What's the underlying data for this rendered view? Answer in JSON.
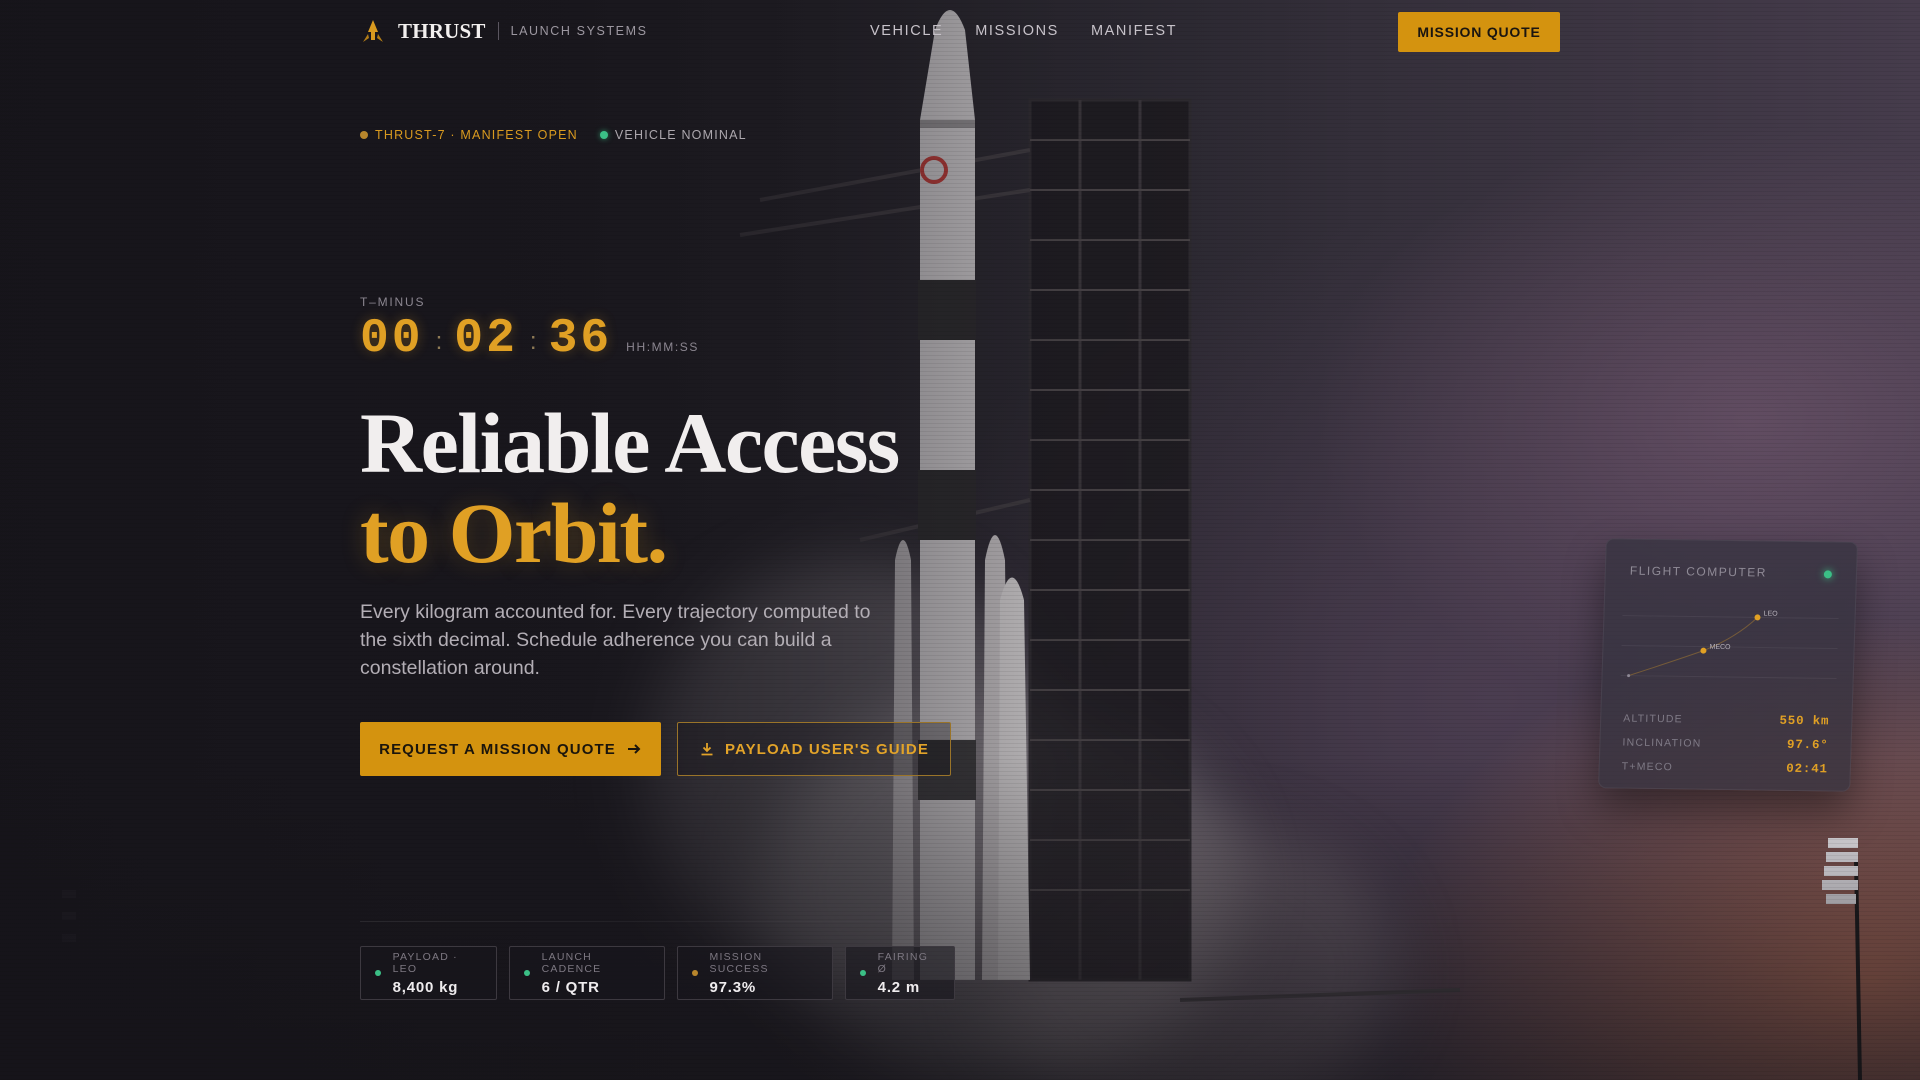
{
  "nav": {
    "brand_name": "THRUST",
    "brand_sub": "LAUNCH SYSTEMS",
    "links": [
      "VEHICLE",
      "MISSIONS",
      "MANIFEST"
    ],
    "cta_label": "MISSION QUOTE"
  },
  "status": {
    "manifest": "THRUST-7 · MANIFEST OPEN",
    "vehicle": "VEHICLE NOMINAL"
  },
  "countdown": {
    "label": "T–MINUS",
    "hours": "00",
    "minutes": "02",
    "seconds": "36",
    "unit": "HH:MM:SS"
  },
  "hero": {
    "headline_line1": "Reliable Access",
    "headline_line2": "to Orbit.",
    "lead": "Every kilogram accounted for. Every trajectory computed to the sixth decimal. Schedule adherence you can build a constellation around.",
    "primary_cta": "REQUEST A MISSION QUOTE",
    "secondary_cta": "PAYLOAD USER'S GUIDE"
  },
  "stats": [
    {
      "label": "PAYLOAD · LEO",
      "value": "8,400 kg",
      "dot": "#3bbf86"
    },
    {
      "label": "LAUNCH CADENCE",
      "value": "6 / QTR",
      "dot": "#3bbf86"
    },
    {
      "label": "MISSION SUCCESS",
      "value": "97.3%",
      "dot": "#b8862c"
    },
    {
      "label": "FAIRING Ø",
      "value": "4.2 m",
      "dot": "#3bbf86"
    }
  ],
  "flight_computer": {
    "title": "FLIGHT COMPUTER",
    "plot_labels": {
      "leo": "LEO",
      "meco": "MECO"
    },
    "rows": [
      {
        "key": "ALTITUDE",
        "value": "550 km"
      },
      {
        "key": "INCLINATION",
        "value": "97.6°"
      },
      {
        "key": "T+MECO",
        "value": "02:41"
      }
    ]
  },
  "colors": {
    "accent": "#d4930f",
    "accent_text": "#e0a024",
    "status_green": "#3bbf86",
    "background": "#1d1b21"
  },
  "icons": {
    "brand": "rocket-logo-icon",
    "arrow": "arrow-right-icon",
    "download": "download-icon"
  }
}
